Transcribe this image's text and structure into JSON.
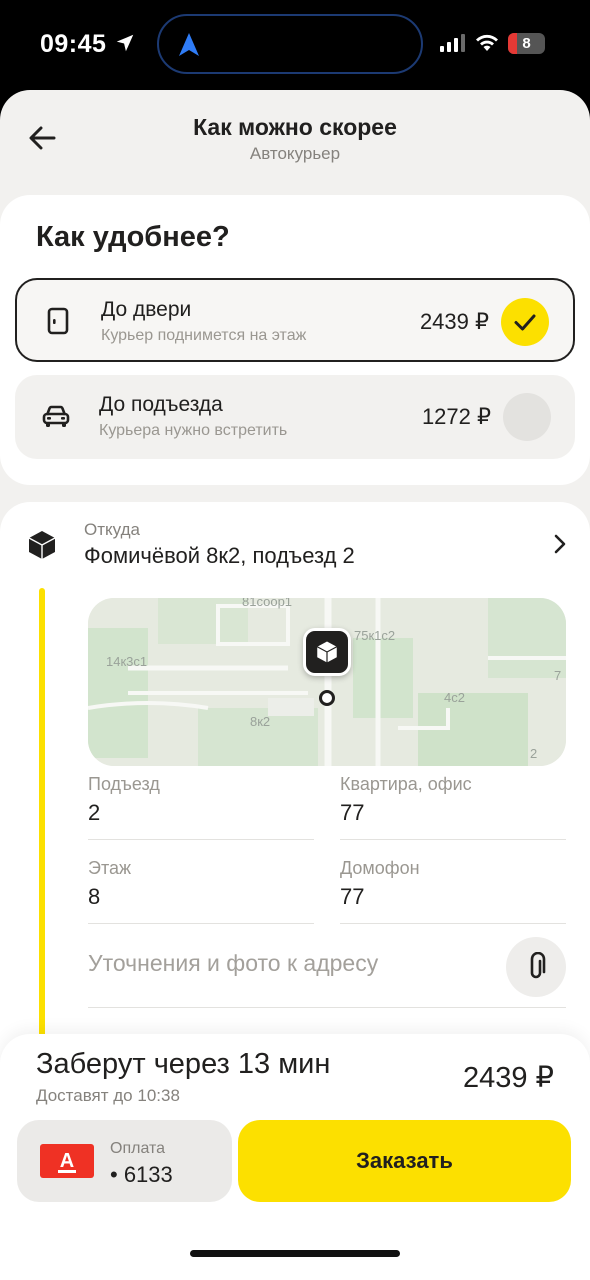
{
  "status_bar": {
    "time": "09:45",
    "battery": "8"
  },
  "header": {
    "title": "Как можно скорее",
    "subtitle": "Автокурьер"
  },
  "delivery_options": {
    "heading": "Как удобнее?",
    "items": [
      {
        "icon": "door-icon",
        "title": "До двери",
        "description": "Курьер поднимется на этаж",
        "price": "2439 ₽",
        "selected": true
      },
      {
        "icon": "car-icon",
        "title": "До подъезда",
        "description": "Курьера нужно встретить",
        "price": "1272 ₽",
        "selected": false
      }
    ]
  },
  "pickup": {
    "label": "Откуда",
    "address": "Фомичёвой 8к2, подъезд 2",
    "map_labels": [
      "81соор1",
      "75к1с2",
      "14к3с1",
      "4с2",
      "8к2",
      "7",
      "2"
    ],
    "fields": {
      "entrance": {
        "label": "Подъезд",
        "value": "2"
      },
      "apartment": {
        "label": "Квартира, офис",
        "value": "77"
      },
      "floor": {
        "label": "Этаж",
        "value": "8"
      },
      "intercom": {
        "label": "Домофон",
        "value": "77"
      }
    },
    "notes_placeholder": "Уточнения и фото к адресу"
  },
  "order": {
    "eta_title": "Заберут через 13 мин",
    "eta_subtitle": "Доставят до 10:38",
    "price": "2439 ₽",
    "payment_label": "Оплата",
    "payment_card": "• 6133",
    "bank_letter": "А",
    "order_button": "Заказать"
  },
  "colors": {
    "accent": "#fce000",
    "bank": "#ef3124",
    "text": "#21201f",
    "secondary_text": "#85827d"
  }
}
